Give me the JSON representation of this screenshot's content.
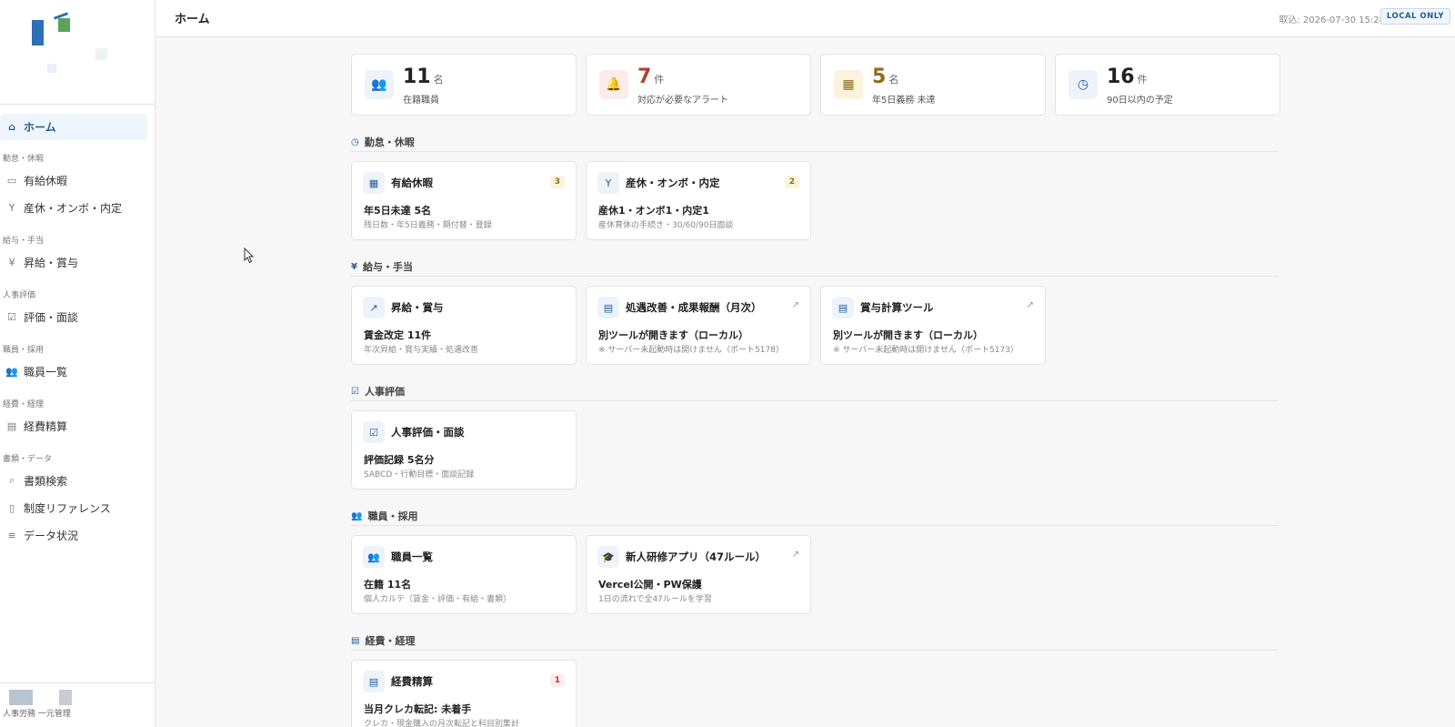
{
  "app": {
    "footer_text": "人事労務 一元管理"
  },
  "header": {
    "title": "ホーム",
    "sync_label": "取込: 2026-07-30 15:28",
    "badge": "LOCAL ONLY"
  },
  "sidebar": {
    "home": "ホーム",
    "groups": [
      {
        "label": "勤怠・休暇",
        "items": [
          "有給休暇",
          "産休・オンボ・内定"
        ]
      },
      {
        "label": "給与・手当",
        "items": [
          "昇給・賞与"
        ]
      },
      {
        "label": "人事評価",
        "items": [
          "評価・面談"
        ]
      },
      {
        "label": "職員・採用",
        "items": [
          "職員一覧"
        ]
      },
      {
        "label": "経費・経理",
        "items": [
          "経費精算"
        ]
      },
      {
        "label": "書類・データ",
        "items": [
          "書類検索",
          "制度リファレンス",
          "データ状況"
        ]
      }
    ]
  },
  "stats": [
    {
      "value": "11",
      "unit": "名",
      "label": "在籍職員",
      "icon": "users-icon",
      "color": "#222222"
    },
    {
      "value": "7",
      "unit": "件",
      "label": "対応が必要なアラート",
      "icon": "bell-icon",
      "color": "#b3402f"
    },
    {
      "value": "5",
      "unit": "名",
      "label": "年5日義務 未達",
      "icon": "calendar-icon",
      "color": "#8a6d1f"
    },
    {
      "value": "16",
      "unit": "件",
      "label": "90日以内の予定",
      "icon": "clock-icon",
      "color": "#222222"
    }
  ],
  "sections": [
    {
      "title": "勤怠・休暇",
      "cards": [
        {
          "title": "有給休暇",
          "badge": "3",
          "main": "年5日未達 5名",
          "sub": "残日数・年5日義務・期付替・登録"
        },
        {
          "title": "産休・オンボ・内定",
          "badge": "2",
          "main": "産休1・オンボ1・内定1",
          "sub": "産休育休の手続き・30/60/90日面談"
        }
      ]
    },
    {
      "title": "給与・手当",
      "cards": [
        {
          "title": "昇給・賞与",
          "main": "賃金改定 11件",
          "sub": "年次昇給・賞与実績・処遇改善"
        },
        {
          "title": "処遇改善・成果報酬（月次）",
          "main": "別ツールが開きます（ローカル）",
          "sub": "※ サーバー未起動時は開けません（ポート5178）"
        },
        {
          "title": "賞与計算ツール",
          "main": "別ツールが開きます（ローカル）",
          "sub": "※ サーバー未起動時は開けません（ポート5173）"
        }
      ]
    },
    {
      "title": "人事評価",
      "cards": [
        {
          "title": "人事評価・面談",
          "main": "評価記録 5名分",
          "sub": "SABCD・行動目標・面談記録"
        }
      ]
    },
    {
      "title": "職員・採用",
      "cards": [
        {
          "title": "職員一覧",
          "main": "在籍 11名",
          "sub": "個人カルテ（賃金・評価・有給・書類）"
        },
        {
          "title": "新人研修アプリ（47ルール）",
          "main": "Vercel公開・PW保護",
          "sub": "1日の流れで全47ルールを学習"
        }
      ]
    },
    {
      "title": "経費・経理",
      "cards": [
        {
          "title": "経費精算",
          "badge": "1",
          "main": "当月クレカ転記: 未着手",
          "sub": "クレカ・現金購入の月次転記と科目別集計"
        }
      ]
    }
  ]
}
